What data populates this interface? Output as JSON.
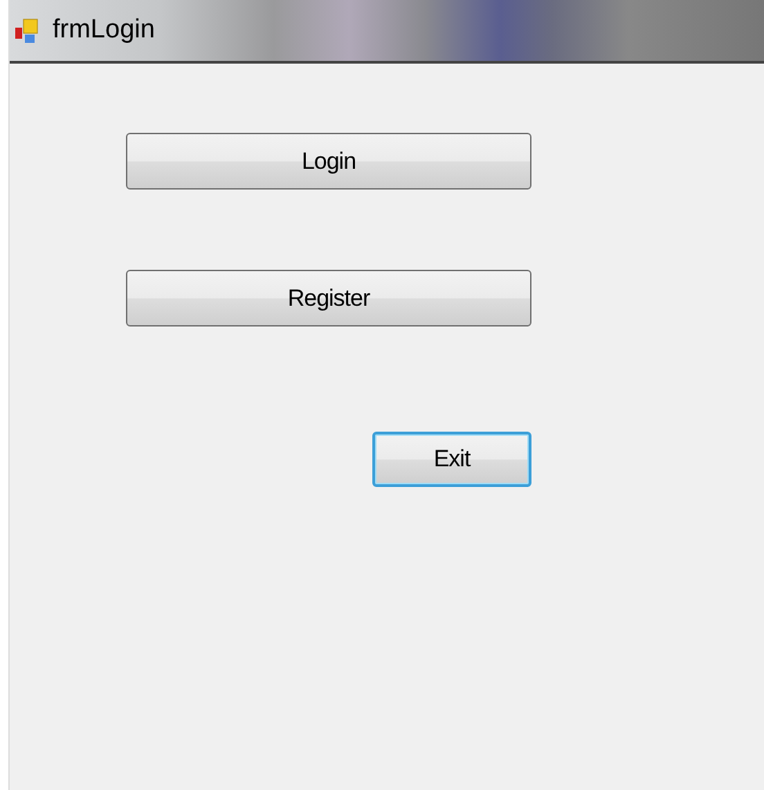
{
  "window": {
    "title": "frmLogin"
  },
  "buttons": [
    {
      "label": "Login",
      "kind": "wide",
      "focused": false
    },
    {
      "label": "Register",
      "kind": "wide",
      "focused": false
    },
    {
      "label": "Exit",
      "kind": "compact",
      "focused": true
    }
  ]
}
